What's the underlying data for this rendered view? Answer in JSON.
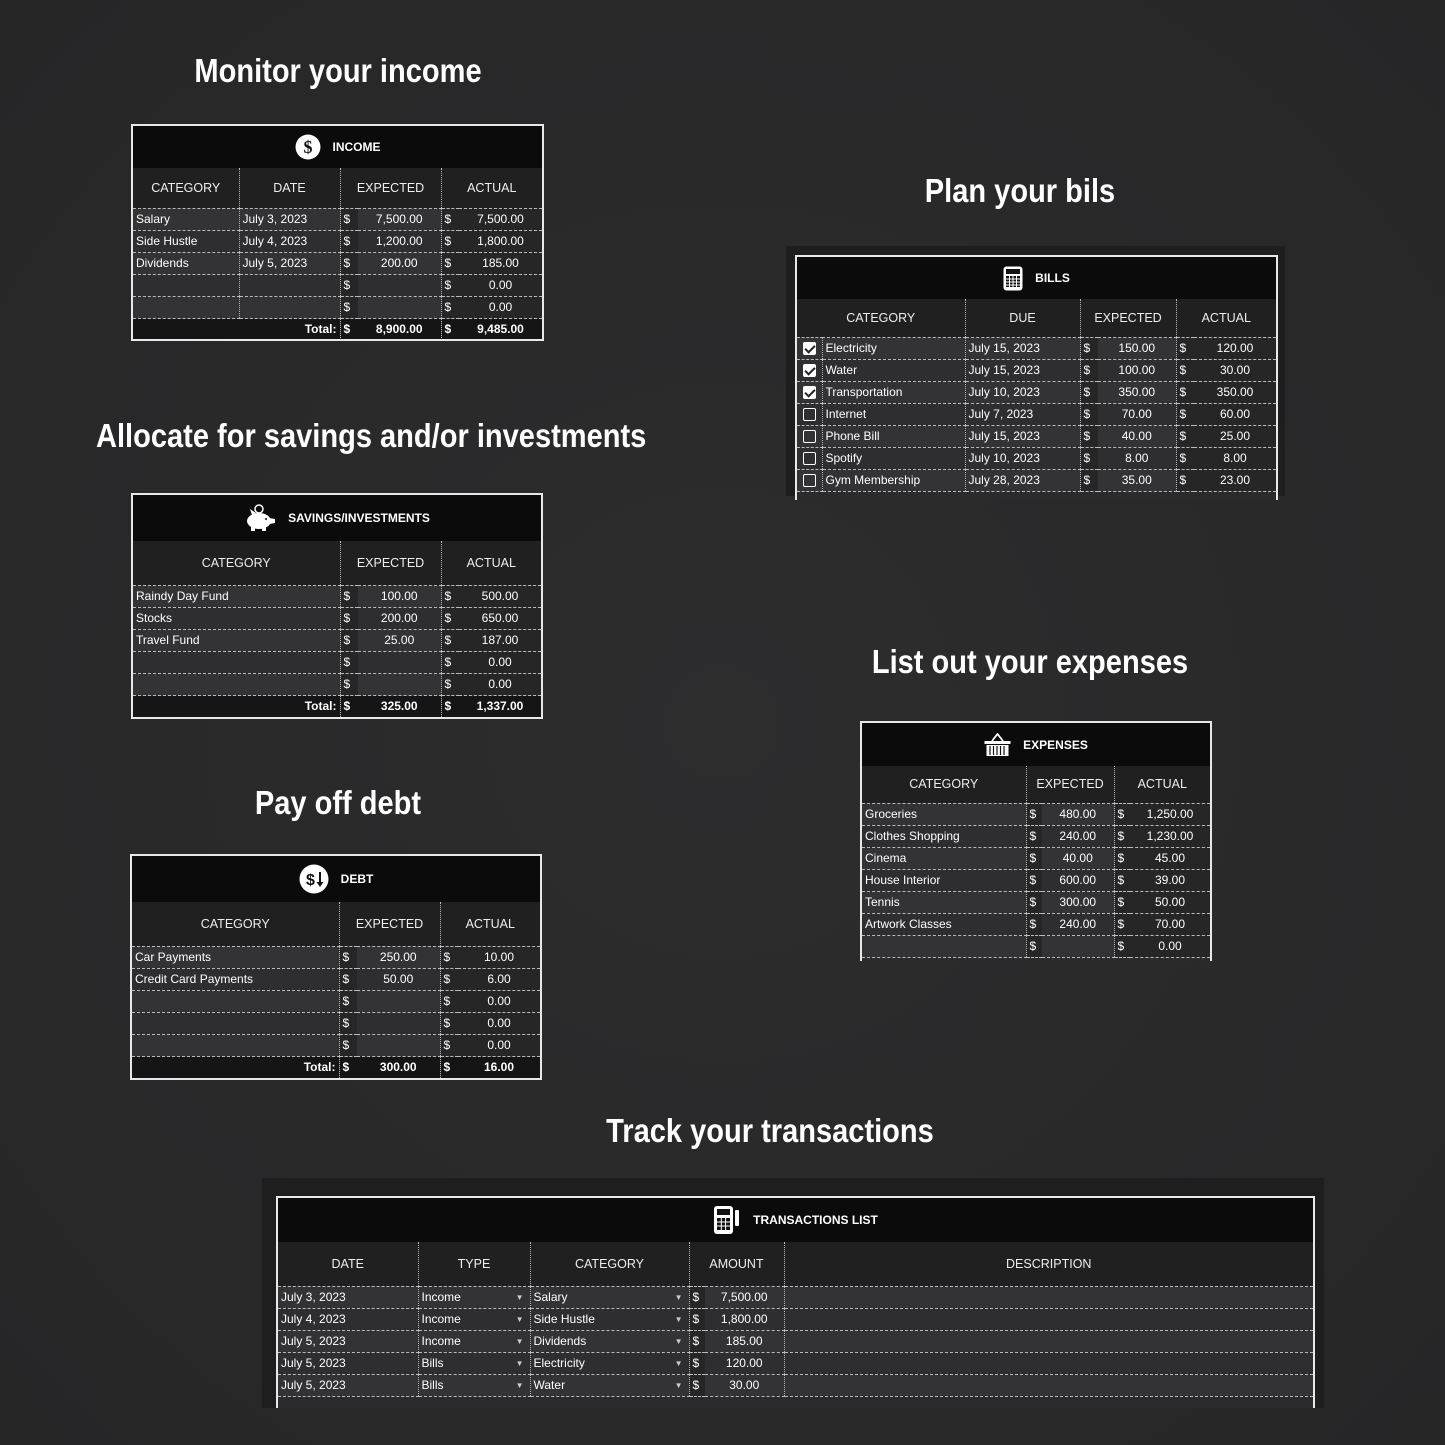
{
  "headings": {
    "income": "Monitor your income",
    "bills": "Plan your bils",
    "savings": "Allocate for savings and/or investments",
    "expenses": "List out your expenses",
    "debt": "Pay off debt",
    "transactions": "Track your transactions"
  },
  "currency": "$",
  "total_label": "Total:",
  "income": {
    "title": "INCOME",
    "icon": "dollar-coin-icon",
    "columns": [
      "CATEGORY",
      "DATE",
      "EXPECTED",
      "ACTUAL"
    ],
    "rows": [
      {
        "category": "Salary",
        "date": "July 3, 2023",
        "expected": "7,500.00",
        "actual": "7,500.00"
      },
      {
        "category": "Side Hustle",
        "date": "July 4, 2023",
        "expected": "1,200.00",
        "actual": "1,800.00"
      },
      {
        "category": "Dividends",
        "date": "July 5, 2023",
        "expected": "200.00",
        "actual": "185.00"
      },
      {
        "category": "",
        "date": "",
        "expected": "",
        "actual": "0.00"
      },
      {
        "category": "",
        "date": "",
        "expected": "",
        "actual": "0.00"
      }
    ],
    "total": {
      "expected": "8,900.00",
      "actual": "9,485.00"
    }
  },
  "bills": {
    "title": "BILLS",
    "icon": "calculator-icon",
    "columns": [
      "CATEGORY",
      "DUE",
      "EXPECTED",
      "ACTUAL"
    ],
    "rows": [
      {
        "paid": true,
        "category": "Electricity",
        "due": "July 15, 2023",
        "expected": "150.00",
        "actual": "120.00"
      },
      {
        "paid": true,
        "category": "Water",
        "due": "July 15, 2023",
        "expected": "100.00",
        "actual": "30.00"
      },
      {
        "paid": true,
        "category": "Transportation",
        "due": "July 10, 2023",
        "expected": "350.00",
        "actual": "350.00"
      },
      {
        "paid": false,
        "category": "Internet",
        "due": "July 7, 2023",
        "expected": "70.00",
        "actual": "60.00"
      },
      {
        "paid": false,
        "category": "Phone Bill",
        "due": "July 15, 2023",
        "expected": "40.00",
        "actual": "25.00"
      },
      {
        "paid": false,
        "category": "Spotify",
        "due": "July 10, 2023",
        "expected": "8.00",
        "actual": "8.00"
      },
      {
        "paid": false,
        "category": "Gym Membership",
        "due": "July 28, 2023",
        "expected": "35.00",
        "actual": "23.00"
      }
    ]
  },
  "savings": {
    "title": "SAVINGS/INVESTMENTS",
    "icon": "piggy-bank-icon",
    "columns": [
      "CATEGORY",
      "EXPECTED",
      "ACTUAL"
    ],
    "rows": [
      {
        "category": "Raindy Day Fund",
        "expected": "100.00",
        "actual": "500.00"
      },
      {
        "category": "Stocks",
        "expected": "200.00",
        "actual": "650.00"
      },
      {
        "category": "Travel Fund",
        "expected": "25.00",
        "actual": "187.00"
      },
      {
        "category": "",
        "expected": "",
        "actual": "0.00"
      },
      {
        "category": "",
        "expected": "",
        "actual": "0.00"
      }
    ],
    "total": {
      "expected": "325.00",
      "actual": "1,337.00"
    }
  },
  "expenses": {
    "title": "EXPENSES",
    "icon": "shopping-basket-icon",
    "columns": [
      "CATEGORY",
      "EXPECTED",
      "ACTUAL"
    ],
    "rows": [
      {
        "category": "Groceries",
        "expected": "480.00",
        "actual": "1,250.00"
      },
      {
        "category": "Clothes Shopping",
        "expected": "240.00",
        "actual": "1,230.00"
      },
      {
        "category": "Cinema",
        "expected": "40.00",
        "actual": "45.00"
      },
      {
        "category": "House Interior",
        "expected": "600.00",
        "actual": "39.00"
      },
      {
        "category": "Tennis",
        "expected": "300.00",
        "actual": "50.00"
      },
      {
        "category": "Artwork Classes",
        "expected": "240.00",
        "actual": "70.00"
      },
      {
        "category": "",
        "expected": "",
        "actual": "0.00"
      }
    ]
  },
  "debt": {
    "title": "DEBT",
    "icon": "dollar-down-icon",
    "columns": [
      "CATEGORY",
      "EXPECTED",
      "ACTUAL"
    ],
    "rows": [
      {
        "category": "Car Payments",
        "expected": "250.00",
        "actual": "10.00"
      },
      {
        "category": "Credit Card Payments",
        "expected": "50.00",
        "actual": "6.00"
      },
      {
        "category": "",
        "expected": "",
        "actual": "0.00"
      },
      {
        "category": "",
        "expected": "",
        "actual": "0.00"
      },
      {
        "category": "",
        "expected": "",
        "actual": "0.00"
      }
    ],
    "total": {
      "expected": "300.00",
      "actual": "16.00"
    }
  },
  "transactions": {
    "title": "TRANSACTIONS LIST",
    "icon": "card-terminal-icon",
    "columns": [
      "DATE",
      "TYPE",
      "CATEGORY",
      "AMOUNT",
      "DESCRIPTION"
    ],
    "rows": [
      {
        "date": "July 3, 2023",
        "type": "Income",
        "category": "Salary",
        "amount": "7,500.00",
        "description": ""
      },
      {
        "date": "July 4, 2023",
        "type": "Income",
        "category": "Side Hustle",
        "amount": "1,800.00",
        "description": ""
      },
      {
        "date": "July 5, 2023",
        "type": "Income",
        "category": "Dividends",
        "amount": "185.00",
        "description": ""
      },
      {
        "date": "July 5, 2023",
        "type": "Bills",
        "category": "Electricity",
        "amount": "120.00",
        "description": ""
      },
      {
        "date": "July 5, 2023",
        "type": "Bills",
        "category": "Water",
        "amount": "30.00",
        "description": ""
      }
    ]
  }
}
